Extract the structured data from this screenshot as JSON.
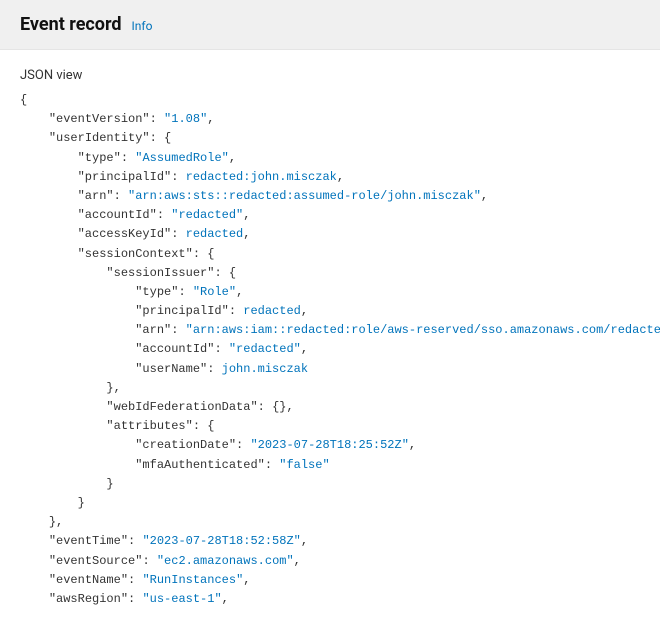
{
  "header": {
    "title": "Event record",
    "info_label": "Info"
  },
  "json_view_label": "JSON view",
  "event": {
    "eventVersion": "1.08",
    "userIdentity": {
      "type": "AssumedRole",
      "principalId": "redacted:john.misczak",
      "arn": "arn:aws:sts::redacted:assumed-role/john.misczak",
      "accountId": "redacted",
      "accessKeyId": "redacted",
      "sessionContext": {
        "sessionIssuer": {
          "type": "Role",
          "principalId": "redacted",
          "arn": "arn:aws:iam::redacted:role/aws-reserved/sso.amazonaws.com/redacted",
          "accountId": "redacted",
          "userName": "john.misczak"
        },
        "webIdFederationData": "{}",
        "attributes": {
          "creationDate": "2023-07-28T18:25:52Z",
          "mfaAuthenticated": "false"
        }
      }
    },
    "eventTime": "2023-07-28T18:52:58Z",
    "eventSource": "ec2.amazonaws.com",
    "eventName": "RunInstances",
    "awsRegion": "us-east-1"
  }
}
